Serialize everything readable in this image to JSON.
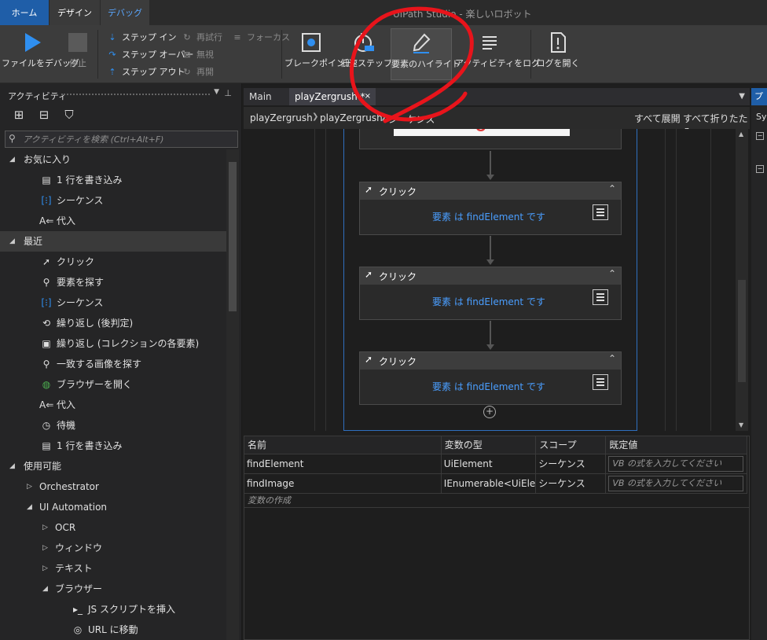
{
  "window": {
    "title": "UiPath Studio - 楽しいロボット"
  },
  "ribbon_tabs": [
    "ホーム",
    "デザイン",
    "デバッグ"
  ],
  "ribbon": {
    "run_label": "ファイルをデバッグ",
    "stop_label": "停止",
    "step_into": "ステップ イン",
    "step_over": "ステップ オーバー",
    "step_out": "ステップ アウト",
    "retry": "再試行",
    "ignore": "無視",
    "restart": "再開",
    "focus": "フォーカス",
    "breakpoint": "ブレークポイント",
    "slow_step": "低速ステップ",
    "highlight": "要素のハイライト",
    "log_activities": "アクティビティをログ",
    "open_logs": "ログを開く"
  },
  "activities_panel": {
    "title": "アクティビティ",
    "search_placeholder": "アクティビティを検索 (Ctrl+Alt+F)",
    "favorites_label": "お気に入り",
    "favorites": [
      {
        "label": "1 行を書き込み",
        "icon": "write-line-icon"
      },
      {
        "label": "シーケンス",
        "icon": "sequence-icon"
      },
      {
        "label": "代入",
        "icon": "assign-icon"
      }
    ],
    "recent_label": "最近",
    "recent": [
      {
        "label": "クリック",
        "icon": "click-cursor-icon"
      },
      {
        "label": "要素を探す",
        "icon": "find-element-icon"
      },
      {
        "label": "シーケンス",
        "icon": "sequence-icon"
      },
      {
        "label": "繰り返し (後判定)",
        "icon": "do-while-icon"
      },
      {
        "label": "繰り返し (コレクションの各要素)",
        "icon": "for-each-icon"
      },
      {
        "label": "一致する画像を探す",
        "icon": "find-image-icon"
      },
      {
        "label": "ブラウザーを開く",
        "icon": "globe-icon"
      },
      {
        "label": "代入",
        "icon": "assign-icon"
      },
      {
        "label": "待機",
        "icon": "clock-icon"
      },
      {
        "label": "1 行を書き込み",
        "icon": "write-line-icon"
      }
    ],
    "available_label": "使用可能",
    "available": {
      "orchestrator": "Orchestrator",
      "ui_automation": "UI Automation",
      "ocr": "OCR",
      "window": "ウィンドウ",
      "text": "テキスト",
      "browser": "ブラウザー",
      "inject_js": "JS スクリプトを挿入",
      "navigate_url": "URL に移動"
    }
  },
  "designer": {
    "tabs": [
      "Main",
      "playZergrush *"
    ],
    "breadcrumbs": [
      "playZergrush",
      "playZergrush",
      "シーケンス"
    ],
    "expand_all": "すべて展開",
    "collapse_all": "すべて折りたたみ",
    "activities": [
      {
        "title": "クリック",
        "body": "要素 は findElement です"
      },
      {
        "title": "クリック",
        "body": "要素 は findElement です"
      },
      {
        "title": "クリック",
        "body": "要素 は findElement です"
      }
    ]
  },
  "variables": {
    "headers": [
      "名前",
      "変数の型",
      "スコープ",
      "既定値"
    ],
    "rows": [
      {
        "name": "findElement",
        "type": "UiElement",
        "scope": "シーケンス",
        "default_placeholder": "VB の式を入力してください"
      },
      {
        "name": "findImage",
        "type": "IEnumerable<UiEle",
        "scope": "シーケンス",
        "default_placeholder": "VB の式を入力してください"
      }
    ],
    "create_label": "変数の作成"
  },
  "properties_panel": {
    "title": "プ",
    "item": "Sy"
  },
  "colors": {
    "accent": "#1f5ea8",
    "link": "#4a9eff",
    "annotation": "#e8141b"
  }
}
